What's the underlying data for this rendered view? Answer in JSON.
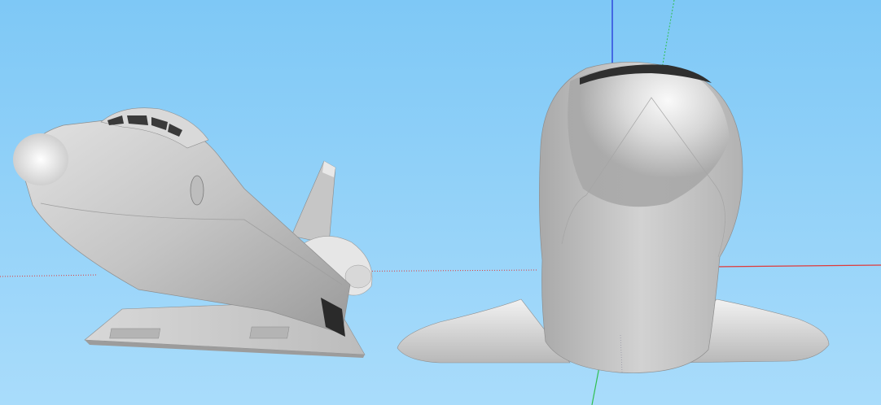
{
  "viewport": {
    "background_top": "#7ec8f6",
    "background_bottom": "#a9dcfb",
    "axis_colors": {
      "x": "#e03a3a",
      "y": "#2fbf4f",
      "z": "#1b28d6"
    }
  },
  "models": [
    {
      "name": "space-shuttle-model",
      "view": "perspective-iso",
      "color": "#c9c9c9"
    },
    {
      "name": "space-shuttle-model",
      "view": "front",
      "color": "#c9c9c9"
    }
  ]
}
